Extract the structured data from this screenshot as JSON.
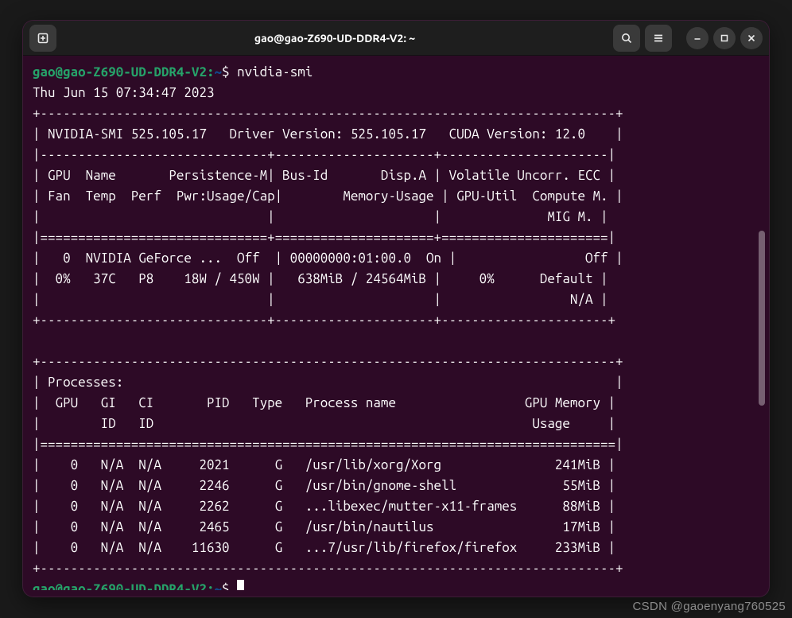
{
  "window": {
    "title": "gao@gao-Z690-UD-DDR4-V2: ~"
  },
  "prompt": {
    "user_host": "gao@gao-Z690-UD-DDR4-V2",
    "path": "~",
    "symbol": "$"
  },
  "command": "nvidia-smi",
  "timestamp": "Thu Jun 15 07:34:47 2023",
  "header_line": "| NVIDIA-SMI 525.105.17   Driver Version: 525.105.17   CUDA Version: 12.0    |",
  "col_line1": "| GPU  Name       Persistence-M| Bus-Id       Disp.A | Volatile Uncorr. ECC |",
  "col_line2": "| Fan  Temp  Perf  Pwr:Usage/Cap|        Memory-Usage | GPU-Util  Compute M. |",
  "col_line3": "|                              |                     |              MIG M. |",
  "gpu_line1": "|   0  NVIDIA GeForce ...  Off  | 00000000:01:00.0  On |                 Off |",
  "gpu_line2": "|  0%   37C   P8    18W / 450W |   638MiB / 24564MiB |     0%      Default |",
  "gpu_line3": "|                              |                     |                 N/A |",
  "proc_header": "| Processes:                                                                 |",
  "proc_cols1": "|  GPU   GI   CI       PID   Type   Process name                 GPU Memory |",
  "proc_cols2": "|        ID   ID                                                  Usage     |",
  "proc_row0": "|    0   N/A  N/A     2021      G   /usr/lib/xorg/Xorg               241MiB |",
  "proc_row1": "|    0   N/A  N/A     2246      G   /usr/bin/gnome-shell              55MiB |",
  "proc_row2": "|    0   N/A  N/A     2262      G   ...libexec/mutter-x11-frames      88MiB |",
  "proc_row3": "|    0   N/A  N/A     2465      G   /usr/bin/nautilus                 17MiB |",
  "proc_row4": "|    0   N/A  N/A    11630      G   ...7/usr/lib/firefox/firefox     233MiB |",
  "ascii": {
    "top": "+----------------------------------------------------------------------------+",
    "sep3": "|------------------------------+---------------------+----------------------|",
    "sep3_thick": "|==============================+=====================+======================|",
    "bottom3": "+------------------------------+---------------------+----------------------+",
    "proc_sep": "|============================================================================|"
  },
  "watermark": "CSDN @gaoenyang760525"
}
